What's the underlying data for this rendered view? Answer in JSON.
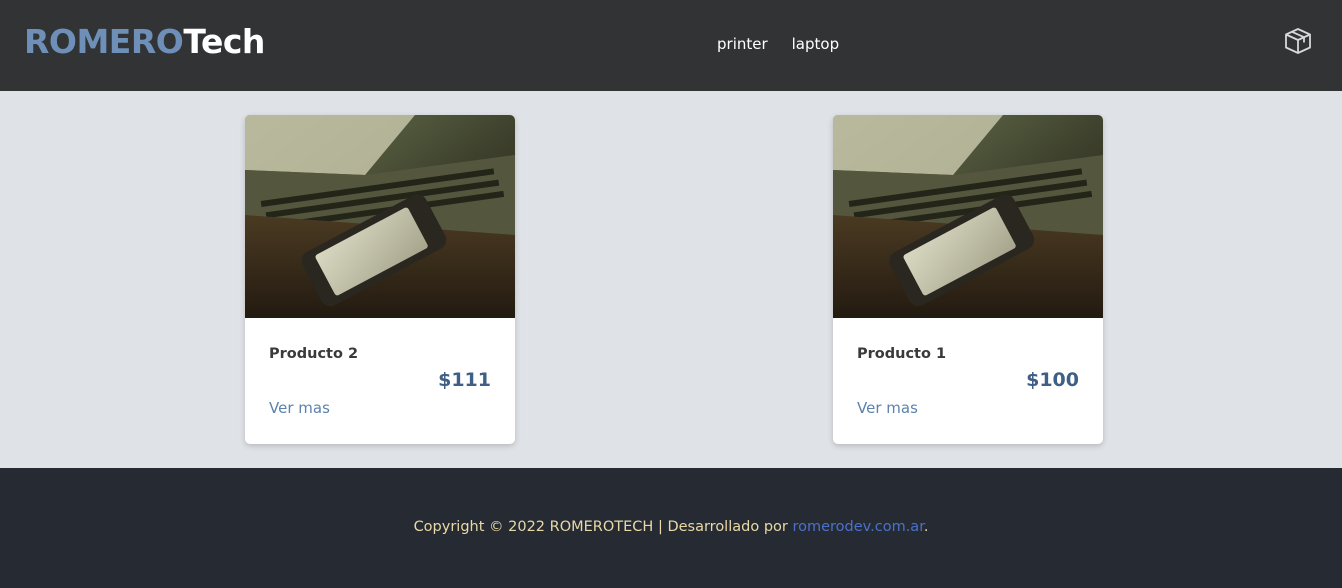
{
  "brand": {
    "part1": "ROMERO",
    "part2": "Tech"
  },
  "nav": {
    "links": [
      {
        "label": "printer"
      },
      {
        "label": "laptop"
      }
    ],
    "cart_icon": "package-box-icon"
  },
  "products": [
    {
      "name": "Producto 2",
      "price": "$111",
      "link": "Ver mas",
      "image": "laptop-smartphone-photo"
    },
    {
      "name": "Producto 1",
      "price": "$100",
      "link": "Ver mas",
      "image": "laptop-smartphone-photo"
    }
  ],
  "footer": {
    "text": "Copyright © 2022 ROMEROTECH | Desarrollado por ",
    "link": "romerodev.com.ar",
    "end": "."
  },
  "colors": {
    "navbar": "#313334",
    "brand_accent": "#6d8fb8",
    "price": "#3f5f86",
    "link": "#5c82ad",
    "footer": "#262a32",
    "footer_text": "#e8d9a7",
    "footer_link": "#4b72c9"
  }
}
